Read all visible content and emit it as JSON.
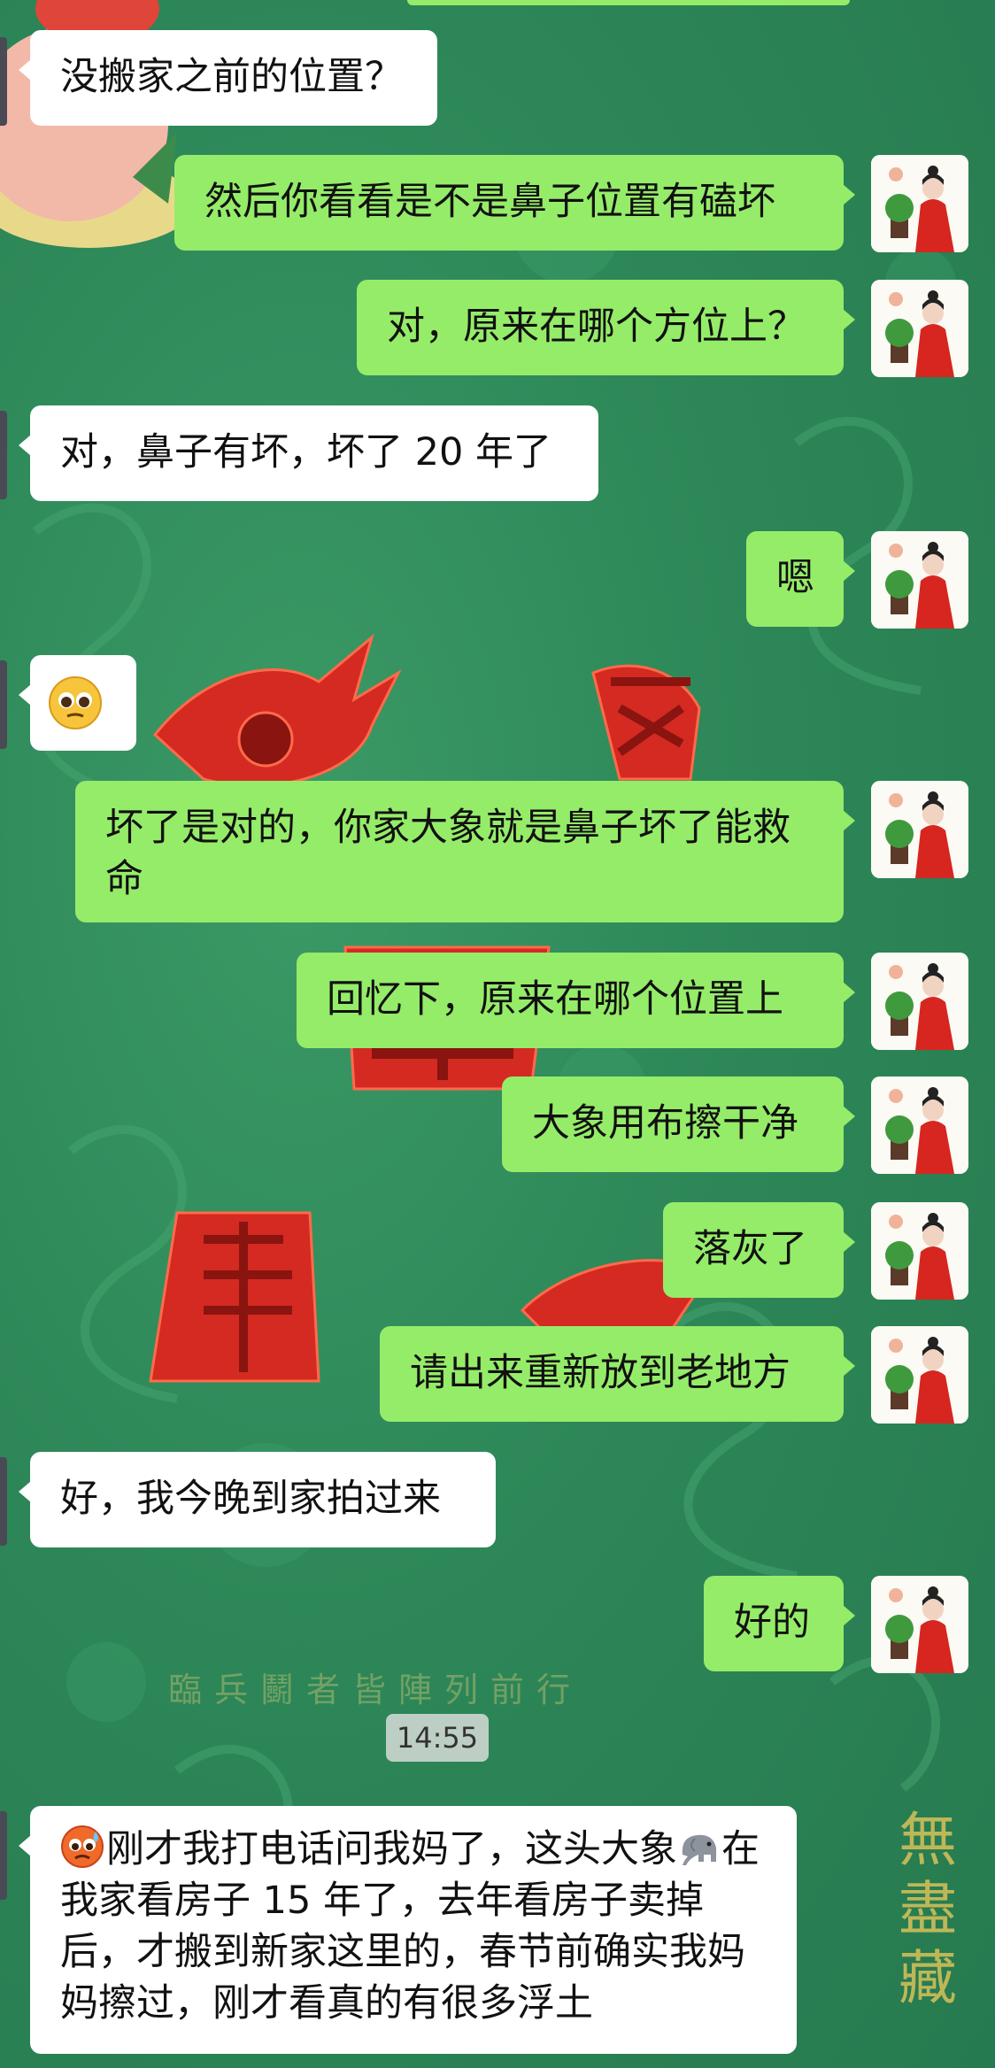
{
  "colors": {
    "background": "#2e8a5a",
    "bubble_self": "#95ec69",
    "bubble_other": "#ffffff",
    "decor_red": "#d42a22",
    "decor_gold": "#d9c25a"
  },
  "messages": [
    {
      "id": "m1",
      "side": "left",
      "text": "没搬家之前的位置？"
    },
    {
      "id": "m2",
      "side": "right",
      "text": "然后你看看是不是鼻子位置有磕坏"
    },
    {
      "id": "m3",
      "side": "right",
      "text": "对，原来在哪个方位上？"
    },
    {
      "id": "m4",
      "side": "left",
      "text": "对，鼻子有坏，坏了 20 年了"
    },
    {
      "id": "m5",
      "side": "right",
      "text": "嗯"
    },
    {
      "id": "m6",
      "side": "left",
      "emoji": "pleading-face"
    },
    {
      "id": "m7",
      "side": "right",
      "text": "坏了是对的，你家大象就是鼻子坏了能救命"
    },
    {
      "id": "m8",
      "side": "right",
      "text": "回忆下，原来在哪个位置上"
    },
    {
      "id": "m9",
      "side": "right",
      "text": "大象用布擦干净"
    },
    {
      "id": "m10",
      "side": "right",
      "text": "落灰了"
    },
    {
      "id": "m11",
      "side": "right",
      "text": "请出来重新放到老地方"
    },
    {
      "id": "m12",
      "side": "left",
      "text": "好，我今晚到家拍过来"
    },
    {
      "id": "m13",
      "side": "right",
      "text": "好的"
    },
    {
      "id": "m14",
      "side": "left",
      "text_a": "刚才我打电话问我妈了，这头大象",
      "text_b": "在我家看房子 15 年了，去年看房子卖掉后，才搬到新家这里的，春节前确实我妈妈擦过，刚才看真的有很多浮土"
    }
  ],
  "timestamp": "14:55",
  "background_text": {
    "motto": "臨兵鬭者皆陣列前行",
    "side": "無盡藏"
  }
}
